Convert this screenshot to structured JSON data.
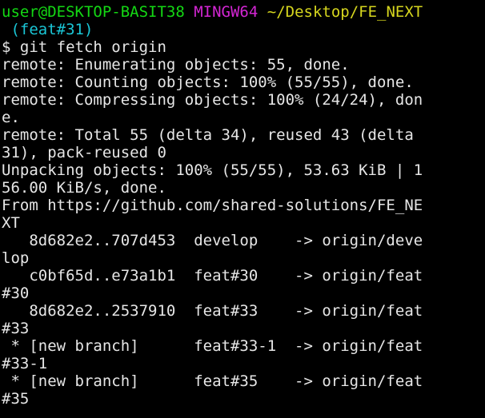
{
  "prompt": {
    "user_host": "user@DESKTOP-BASIT38",
    "shell": "MINGW64",
    "path": "~/Desktop/FE_NEXT",
    "branch": " (feat#31)",
    "symbol": "$ ",
    "command": "git fetch origin"
  },
  "output_lines": [
    "remote: Enumerating objects: 55, done.",
    "remote: Counting objects: 100% (55/55), done.",
    "remote: Compressing objects: 100% (24/24), don",
    "e.",
    "remote: Total 55 (delta 34), reused 43 (delta",
    "31), pack-reused 0",
    "Unpacking objects: 100% (55/55), 53.63 KiB | 1",
    "56.00 KiB/s, done.",
    "From https://github.com/shared-solutions/FE_NE",
    "XT",
    "   8d682e2..707d453  develop    -> origin/deve",
    "lop",
    "   c0bf65d..e73a1b1  feat#30    -> origin/feat",
    "#30",
    "   8d682e2..2537910  feat#33    -> origin/feat",
    "#33",
    " * [new branch]      feat#33-1  -> origin/feat",
    "#33-1",
    " * [new branch]      feat#35    -> origin/feat",
    "#35"
  ],
  "colors": {
    "background": "#000000",
    "text": "#e6e6e6",
    "user_host": "#14d814",
    "shell": "#d326d3",
    "path": "#d6d61e",
    "branch": "#1ac6d6"
  }
}
